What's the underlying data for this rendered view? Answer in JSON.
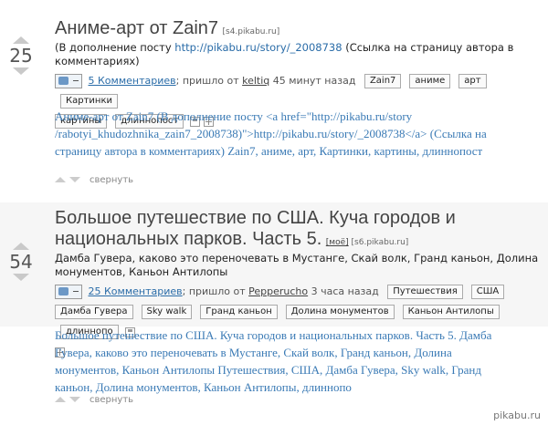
{
  "post1": {
    "rating": "25",
    "title": "Аниме-арт от Zain7",
    "source": "[s4.pikabu.ru]",
    "desc_before": "(В дополнение посту ",
    "desc_link": "http://pikabu.ru/story/_2008738",
    "desc_after": " (Ссылка на страницу автора в комментариях)",
    "comments": "5 Комментариев",
    "posted_prefix": "; пришло от ",
    "author": "keltiq",
    "time": " 45 минут назад",
    "tags": [
      "Zain7",
      "аниме",
      "арт",
      "Картинки",
      "картины",
      "длиннопост"
    ],
    "text": "Аниме-арт от Zain7 (В дополнение посту <a href=\"http://pikabu.ru/story /rabotyi_khudozhnika_zain7_2008738)\">http://pikabu.ru/story/_2008738</a> (Ссылка на страницу автора в комментариях) Zain7, аниме, арт, Картинки, картины, длиннопост",
    "collapse": "свернуть"
  },
  "post2": {
    "rating": "54",
    "title": "Большое путешествие по США. Куча городов и национальных парков. Часть 5.",
    "moe": "[моё]",
    "source": "[s6.pikabu.ru]",
    "desc": "Дамба Гувера, каково это переночевать в Мустанге, Скай волк, Гранд каньон, Долина монументов, Каньон Антилопы",
    "comments": "25 Комментариев",
    "posted_prefix": "; пришло от ",
    "author": "Pepperucho",
    "time": " 3 часа назад",
    "tags": [
      "Путешествия",
      "США",
      "Дамба Гувера",
      "Sky walk",
      "Гранд каньон",
      "Долина монументов",
      "Каньон Антилопы",
      "длиннопо"
    ],
    "text": "Большое путешествие по США. Куча городов и национальных парков. Часть 5. Дамба Гувера, каково это переночевать в Мустанге, Скай волк, Гранд каньон, Долина монументов, Каньон Антилопы Путешествия, США, Дамба Гувера, Sky walk, Гранд каньон, Долина монументов, Каньон Антилопы, длиннопо",
    "collapse": "свернуть"
  },
  "watermark": "pikabu.ru"
}
